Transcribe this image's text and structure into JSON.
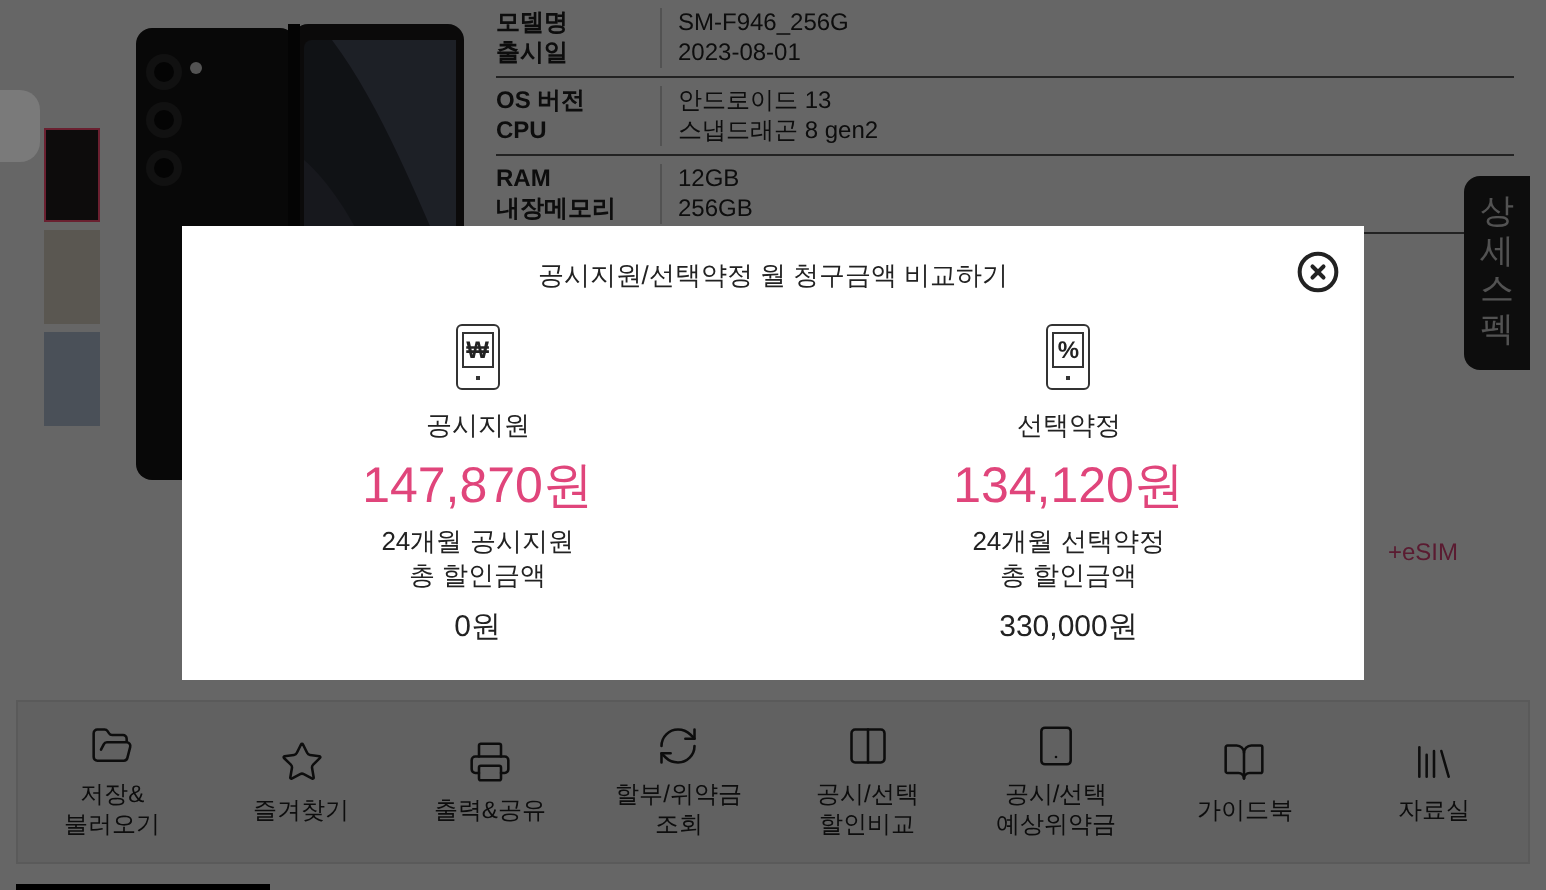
{
  "color_options": [
    {
      "color": "#0d0c0c",
      "selected": true
    },
    {
      "color": "#5a5751",
      "selected": false
    },
    {
      "color": "#4a5058",
      "selected": false
    }
  ],
  "spec_groups": [
    [
      {
        "label": "모델명",
        "value": "SM-F946_256G"
      },
      {
        "label": "출시일",
        "value": "2023-08-01"
      }
    ],
    [
      {
        "label": "OS 버전",
        "value": "안드로이드 13"
      },
      {
        "label": "CPU",
        "value": "스냅드래곤 8 gen2"
      }
    ],
    [
      {
        "label": "RAM",
        "value": "12GB"
      },
      {
        "label": "내장메모리",
        "value": "256GB"
      }
    ]
  ],
  "network_note": "+eSIM",
  "side_tab": "상세스펙",
  "toolbar": [
    {
      "kind": "folder",
      "label": "저장&\n불러오기"
    },
    {
      "kind": "star",
      "label": "즐겨찾기"
    },
    {
      "kind": "printer",
      "label": "출력&공유"
    },
    {
      "kind": "refresh",
      "label": "할부/위약금\n조회"
    },
    {
      "kind": "compare",
      "label": "공시/선택\n할인비교"
    },
    {
      "kind": "tablet",
      "label": "공시/선택\n예상위약금"
    },
    {
      "kind": "book",
      "label": "가이드북"
    },
    {
      "kind": "library",
      "label": "자료실"
    }
  ],
  "modal": {
    "title": "공시지원/선택약정 월 청구금액 비교하기",
    "options": [
      {
        "glyph": "₩",
        "name": "공시지원",
        "monthly": "147,870원",
        "desc": "24개월 공시지원\n총 할인금액",
        "total": "0원"
      },
      {
        "glyph": "%",
        "name": "선택약정",
        "monthly": "134,120원",
        "desc": "24개월 선택약정\n총 할인금액",
        "total": "330,000원"
      }
    ]
  }
}
